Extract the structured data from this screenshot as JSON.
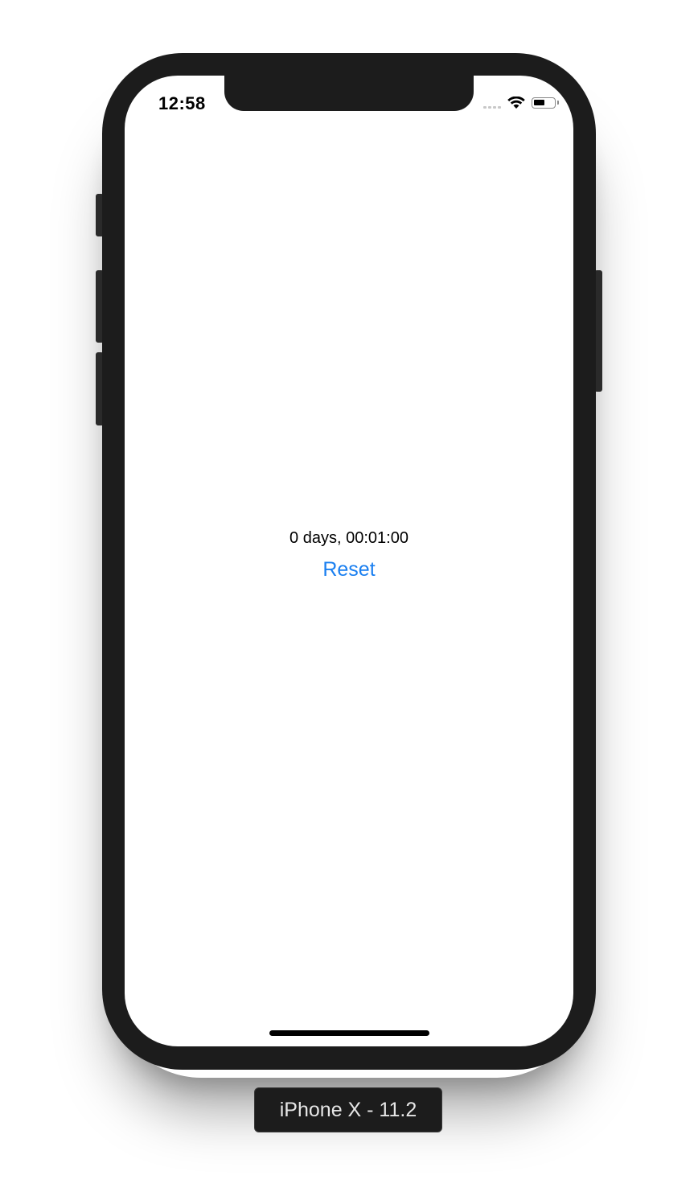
{
  "status_bar": {
    "time": "12:58",
    "signal_icon": "signal-bars-icon",
    "wifi_icon": "wifi-icon",
    "battery_icon": "battery-icon",
    "battery_level": 0.55
  },
  "main": {
    "elapsed_text": "0 days, 00:01:00",
    "reset_label": "Reset",
    "accent_color": "#1a7ff0"
  },
  "simulator": {
    "device_label": "iPhone X - 11.2"
  }
}
